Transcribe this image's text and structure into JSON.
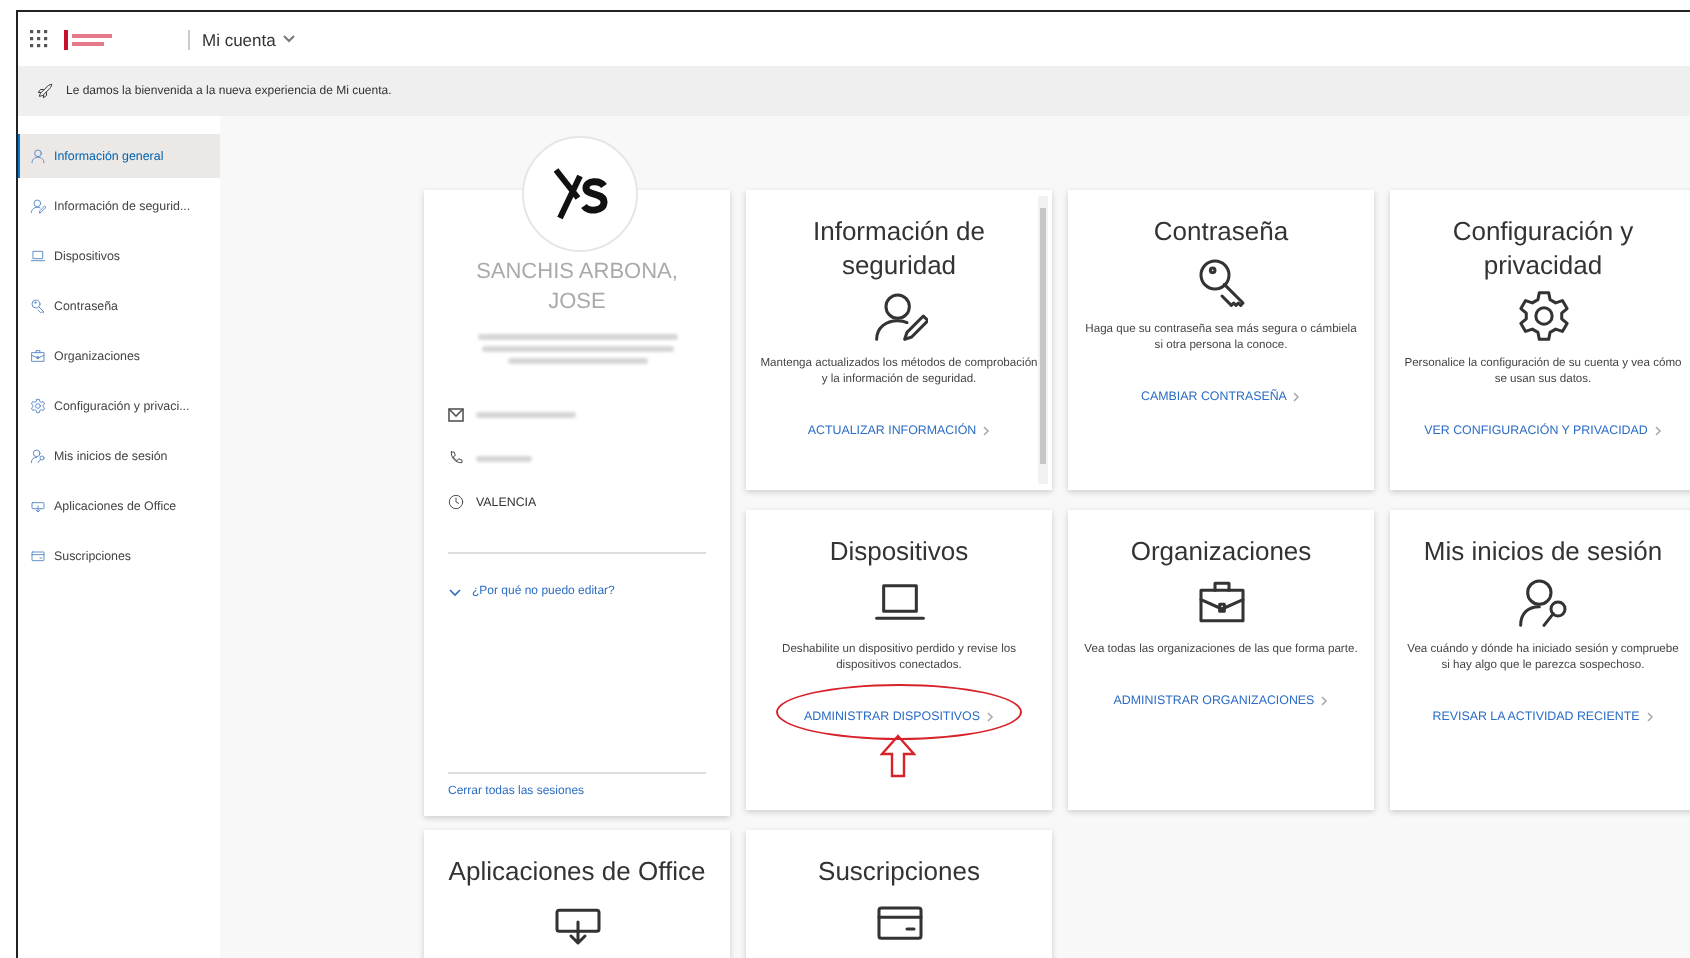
{
  "header": {
    "app_title": "Mi cuenta"
  },
  "banner": {
    "text": "Le damos la bienvenida a la nueva experiencia de Mi cuenta."
  },
  "sidebar": {
    "items": [
      {
        "kind": "person",
        "label": "Información general",
        "selected": true
      },
      {
        "kind": "security",
        "label": "Información de segurid...",
        "selected": false
      },
      {
        "kind": "devices",
        "label": "Dispositivos",
        "selected": false
      },
      {
        "kind": "password",
        "label": "Contraseña",
        "selected": false
      },
      {
        "kind": "organizations",
        "label": "Organizaciones",
        "selected": false
      },
      {
        "kind": "settings",
        "label": "Configuración y privaci...",
        "selected": false
      },
      {
        "kind": "signins",
        "label": "Mis inicios de sesión",
        "selected": false
      },
      {
        "kind": "office",
        "label": "Aplicaciones de Office",
        "selected": false
      },
      {
        "kind": "subscriptions",
        "label": "Suscripciones",
        "selected": false
      }
    ]
  },
  "profile": {
    "name": "SANCHIS ARBONA, JOSE",
    "location": "VALENCIA",
    "edit_link": "¿Por qué no puedo editar?",
    "signout_link": "Cerrar todas las sesiones"
  },
  "cards": [
    {
      "kind": "security",
      "title": "Información de seguridad",
      "description": "Mantenga actualizados los métodos de comprobación y la información de seguridad.",
      "link": "ACTUALIZAR INFORMACIÓN",
      "annotated": false,
      "scrollbar": true
    },
    {
      "kind": "password",
      "title": "Contraseña",
      "description": "Haga que su contraseña sea más segura o cámbiela si otra persona la conoce.",
      "link": "CAMBIAR CONTRASEÑA",
      "annotated": false,
      "scrollbar": false
    },
    {
      "kind": "settings",
      "title": "Configuración y privacidad",
      "description": "Personalice la configuración de su cuenta y vea cómo se usan sus datos.",
      "link": "VER CONFIGURACIÓN Y PRIVACIDAD",
      "annotated": false,
      "scrollbar": false
    },
    {
      "kind": "devices",
      "title": "Dispositivos",
      "description": "Deshabilite un dispositivo perdido y revise los dispositivos conectados.",
      "link": "ADMINISTRAR DISPOSITIVOS",
      "annotated": true,
      "scrollbar": false
    },
    {
      "kind": "organizations",
      "title": "Organizaciones",
      "description": "Vea todas las organizaciones de las que forma parte.",
      "link": "ADMINISTRAR ORGANIZACIONES",
      "annotated": false,
      "scrollbar": false
    },
    {
      "kind": "signins",
      "title": "Mis inicios de sesión",
      "description": "Vea cuándo y dónde ha iniciado sesión y compruebe si hay algo que le parezca sospechoso.",
      "link": "REVISAR LA ACTIVIDAD RECIENTE",
      "annotated": false,
      "scrollbar": false
    },
    {
      "kind": "office",
      "title": "Aplicaciones de Office",
      "annotated": false,
      "scrollbar": false
    },
    {
      "kind": "subscriptions",
      "title": "Suscripciones",
      "annotated": false,
      "scrollbar": false
    }
  ]
}
